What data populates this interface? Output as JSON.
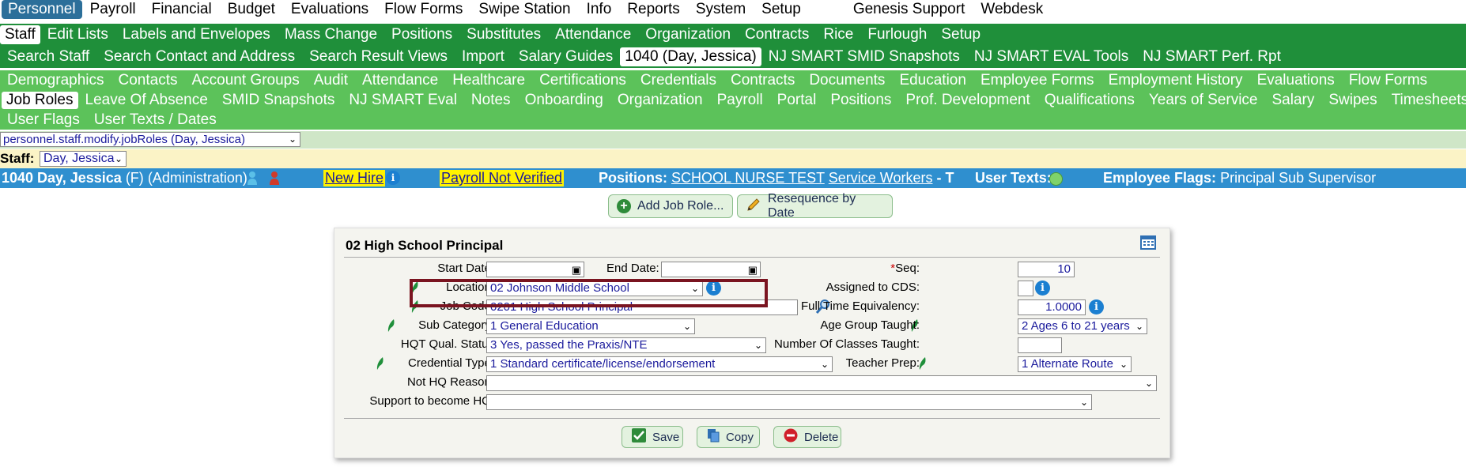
{
  "top_nav": [
    "Personnel",
    "Payroll",
    "Financial",
    "Budget",
    "Evaluations",
    "Flow Forms",
    "Swipe Station",
    "Info",
    "Reports",
    "System",
    "Setup",
    "Genesis Support",
    "Webdesk"
  ],
  "top_nav_selected": "Personnel",
  "nav2": [
    "Staff",
    "Edit Lists",
    "Labels and Envelopes",
    "Mass Change",
    "Positions",
    "Substitutes",
    "Attendance",
    "Organization",
    "Contracts",
    "Rice",
    "Furlough",
    "Setup"
  ],
  "nav2_selected": "Staff",
  "nav3": [
    "Search Staff",
    "Search Contact and Address",
    "Search Result Views",
    "Import",
    "Salary Guides",
    "1040 (Day, Jessica)",
    "NJ SMART SMID Snapshots",
    "NJ SMART EVAL Tools",
    "NJ SMART Perf. Rpt"
  ],
  "nav3_selected": "1040 (Day, Jessica)",
  "nav4_row1": [
    "Demographics",
    "Contacts",
    "Account Groups",
    "Audit",
    "Attendance",
    "Healthcare",
    "Certifications",
    "Credentials",
    "Contracts",
    "Documents",
    "Education",
    "Employee Forms",
    "Employment History",
    "Evaluations",
    "Flow Forms"
  ],
  "nav4_row2": [
    "Job Roles",
    "Leave Of Absence",
    "SMID Snapshots",
    "NJ SMART Eval",
    "Notes",
    "Onboarding",
    "Organization",
    "Payroll",
    "Portal",
    "Positions",
    "Prof. Development",
    "Qualifications",
    "Years of Service",
    "Salary",
    "Swipes",
    "Timesheets"
  ],
  "nav4_row3": [
    "User Flags",
    "User Texts / Dates"
  ],
  "nav4_selected": "Job Roles",
  "path_select": "personnel.staff.modify.jobRoles (Day, Jessica)",
  "staff_label": "Staff:",
  "staff_select": "Day, Jessica",
  "infobar": {
    "name": "1040 Day, Jessica",
    "gender": "(F)",
    "dept": "(Administration)",
    "new_hire": "New Hire",
    "payroll": "Payroll Not Verified",
    "positions_label": "Positions:",
    "position1": "SCHOOL NURSE TEST",
    "position2": "Service Workers",
    "position_suffix": "- T",
    "user_texts_label": "User Texts:",
    "flags_label": "Employee Flags:",
    "flags": "Principal  Sub  Supervisor"
  },
  "buttons": {
    "add_job_role": "Add Job Role...",
    "resequence": "Resequence by Date"
  },
  "panel": {
    "title": "02 High School Principal",
    "start_date_label": "Start Date:",
    "end_date_label": "End Date:",
    "location_label": "Location:",
    "location_value": "02 Johnson Middle School",
    "job_code_label": "Job Code:",
    "job_code_value": "0201 High School Principal",
    "sub_category_label": "Sub Category:",
    "sub_category_value": "1 General Education",
    "hqt_label": "HQT Qual. Status",
    "hqt_value": "3 Yes, passed the Praxis/NTE",
    "credential_label": "Credential Type:",
    "credential_value": "1 Standard certificate/license/endorsement",
    "not_hq_label": "Not HQ Reason:",
    "support_label": "Support to become HQ:",
    "seq_label": "*Seq:",
    "seq_value": "10",
    "cds_label": "Assigned to CDS:",
    "fte_label": "Full Time Equivalency:",
    "fte_value": "1.0000",
    "age_label": "Age Group Taught:",
    "age_value": "2 Ages 6 to 21 years",
    "classes_label": "Number Of Classes Taught:",
    "teacher_prep_label": "Teacher Prep:",
    "teacher_prep_value": "1 Alternate Route",
    "save": "Save",
    "copy": "Copy",
    "delete": "Delete"
  }
}
